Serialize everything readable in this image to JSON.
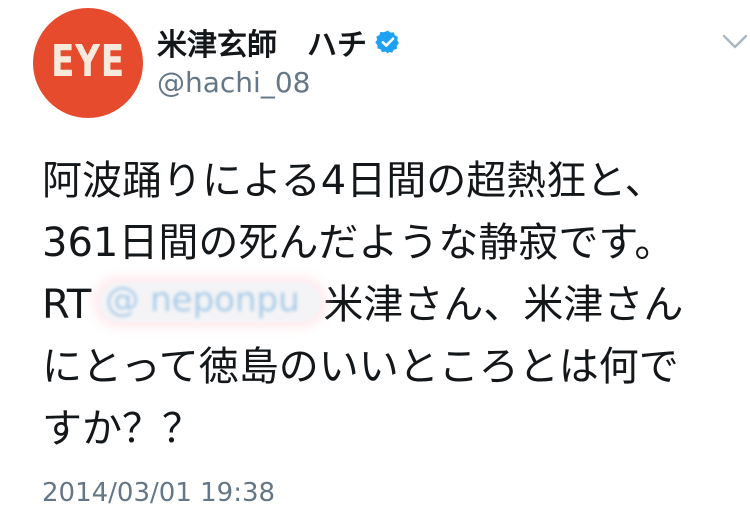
{
  "tweet": {
    "author": {
      "avatar_text": "EYE",
      "display_name": "米津玄師　ハチ",
      "handle": "@hachi_08",
      "verified": true
    },
    "body": {
      "line1": "阿波踊りによる4日間の超熱狂と、",
      "line2": "361日間の死んだような静寂です。",
      "rt_prefix": "RT",
      "mention": "@ neponpu",
      "line3_after": "米津さん、米津さん",
      "line4": "にとって徳島のいいところとは何で",
      "line5": "すか？？"
    },
    "timestamp": "2014/03/01 19:38"
  },
  "colors": {
    "avatar_bg": "#e64b2e",
    "verified_blue": "#1da1f2",
    "handle_gray": "#657786",
    "text": "#14171a"
  },
  "icons": {
    "verified": "verified-badge-icon",
    "menu": "chevron-down-icon"
  }
}
